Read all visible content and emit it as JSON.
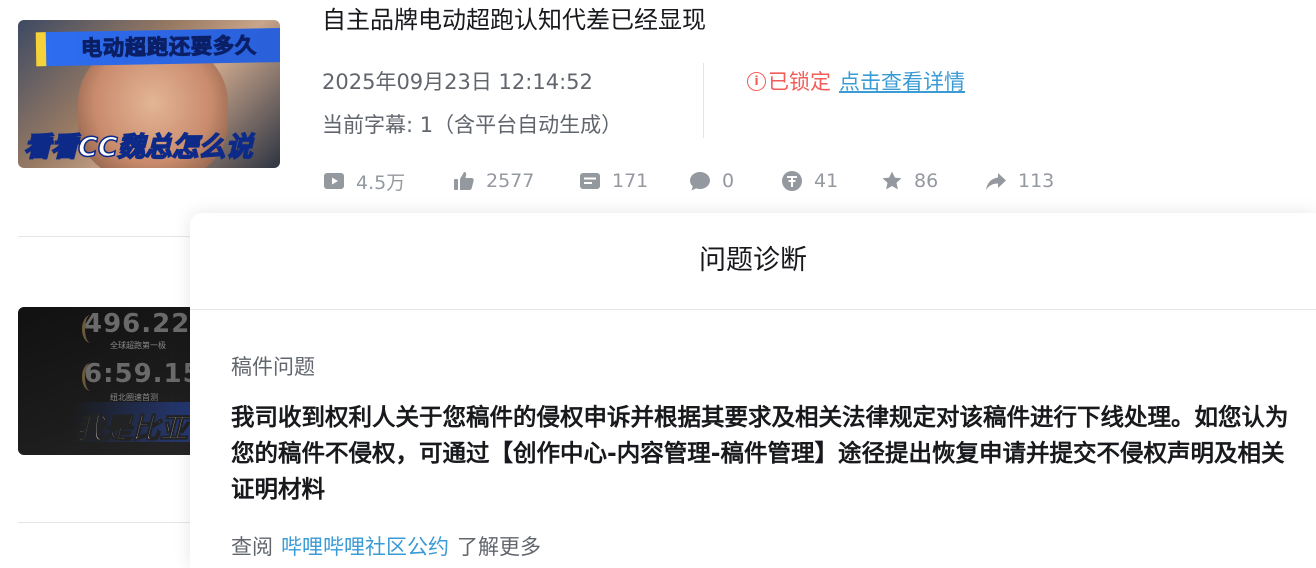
{
  "video1": {
    "title": "自主品牌电动超跑认知代差已经显现",
    "thumbnail": {
      "banner_text": "电动超跑还要多久",
      "caption_text": "看看CC魏总怎么说"
    },
    "datetime": "2025年09月23日 12:14:52",
    "subtitles": "当前字幕: 1（含平台自动生成）",
    "status": {
      "icon": "info-circle-icon",
      "label": "已锁定",
      "link_label": "点击查看详情",
      "color": "#f25d59",
      "link_color": "#3a9bd5"
    },
    "stats": [
      {
        "icon": "play-icon",
        "value": "4.5万"
      },
      {
        "icon": "thumbs-up-icon",
        "value": "2577"
      },
      {
        "icon": "danmaku-icon",
        "value": "171"
      },
      {
        "icon": "comment-icon",
        "value": "0"
      },
      {
        "icon": "coin-icon",
        "value": "41"
      },
      {
        "icon": "star-icon",
        "value": "86"
      },
      {
        "icon": "share-icon",
        "value": "113"
      }
    ]
  },
  "video2": {
    "thumbnail": {
      "stat1": "496.22",
      "stat1_sub": "全球超跑第一极",
      "stat2": "6:59.15",
      "stat2_sub": "纽北圈速首测",
      "slogan": "我是比亚"
    }
  },
  "diagnosis_panel": {
    "title": "问题诊断",
    "section_label": "稿件问题",
    "body": "我司收到权利人关于您稿件的侵权申诉并根据其要求及相关法律规定对该稿件进行下线处理。如您认为您的稿件不侵权，可通过【创作中心-内容管理-稿件管理】途径提出恢复申请并提交不侵权声明及相关证明材料",
    "footer_prefix": "查阅",
    "footer_link": "哔哩哔哩社区公约",
    "footer_suffix": "了解更多"
  }
}
